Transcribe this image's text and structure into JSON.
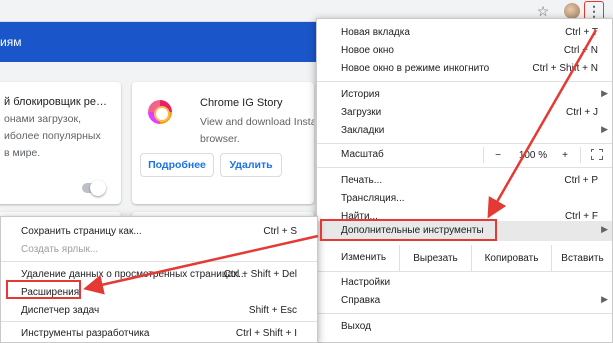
{
  "toolbar": {
    "star_icon": "star-icon",
    "menu_icon": "more-vert-icon"
  },
  "page": {
    "header_text": "иям",
    "colors": {
      "header": "#1a56c9",
      "accent": "#1a73e8",
      "highlight": "#e53935"
    },
    "cards": [
      {
        "lines": [
          "й блокировщик ре…",
          "онами загрузок,",
          "иболее популярных",
          "в мире."
        ]
      },
      {
        "name": "Chrome IG Story",
        "desc_lines": [
          "View and download Instag",
          "browser."
        ],
        "more_label": "Подробнее",
        "remove_label": "Удалить"
      }
    ]
  },
  "main_menu": {
    "new_tab": {
      "label": "Новая вкладка",
      "shortcut": "Ctrl + T"
    },
    "new_window": {
      "label": "Новое окно",
      "shortcut": "Ctrl + N"
    },
    "incognito": {
      "label": "Новое окно в режиме инкогнито",
      "shortcut": "Ctrl + Shift + N"
    },
    "history": {
      "label": "История"
    },
    "downloads": {
      "label": "Загрузки",
      "shortcut": "Ctrl + J"
    },
    "bookmarks": {
      "label": "Закладки"
    },
    "zoom": {
      "label": "Масштаб",
      "minus": "−",
      "value": "100 %",
      "plus": "+"
    },
    "print": {
      "label": "Печать...",
      "shortcut": "Ctrl + P"
    },
    "cast": {
      "label": "Трансляция..."
    },
    "find": {
      "label": "Найти...",
      "shortcut": "Ctrl + F"
    },
    "more_tools": {
      "label": "Дополнительные инструменты"
    },
    "edit": {
      "label": "Изменить",
      "cut": "Вырезать",
      "copy": "Копировать",
      "paste": "Вставить"
    },
    "settings": {
      "label": "Настройки"
    },
    "help": {
      "label": "Справка"
    },
    "exit": {
      "label": "Выход"
    }
  },
  "sub_menu": {
    "save_page": {
      "label": "Сохранить страницу как...",
      "shortcut": "Ctrl + S"
    },
    "create_shortcut": {
      "label": "Создать ярлык..."
    },
    "clear_data": {
      "label": "Удаление данных о просмотренных страницах...",
      "shortcut": "Ctrl + Shift + Del"
    },
    "extensions": {
      "label": "Расширения"
    },
    "task_manager": {
      "label": "Диспетчер задач",
      "shortcut": "Shift + Esc"
    },
    "devtools": {
      "label": "Инструменты разработчика",
      "shortcut": "Ctrl + Shift + I"
    }
  }
}
